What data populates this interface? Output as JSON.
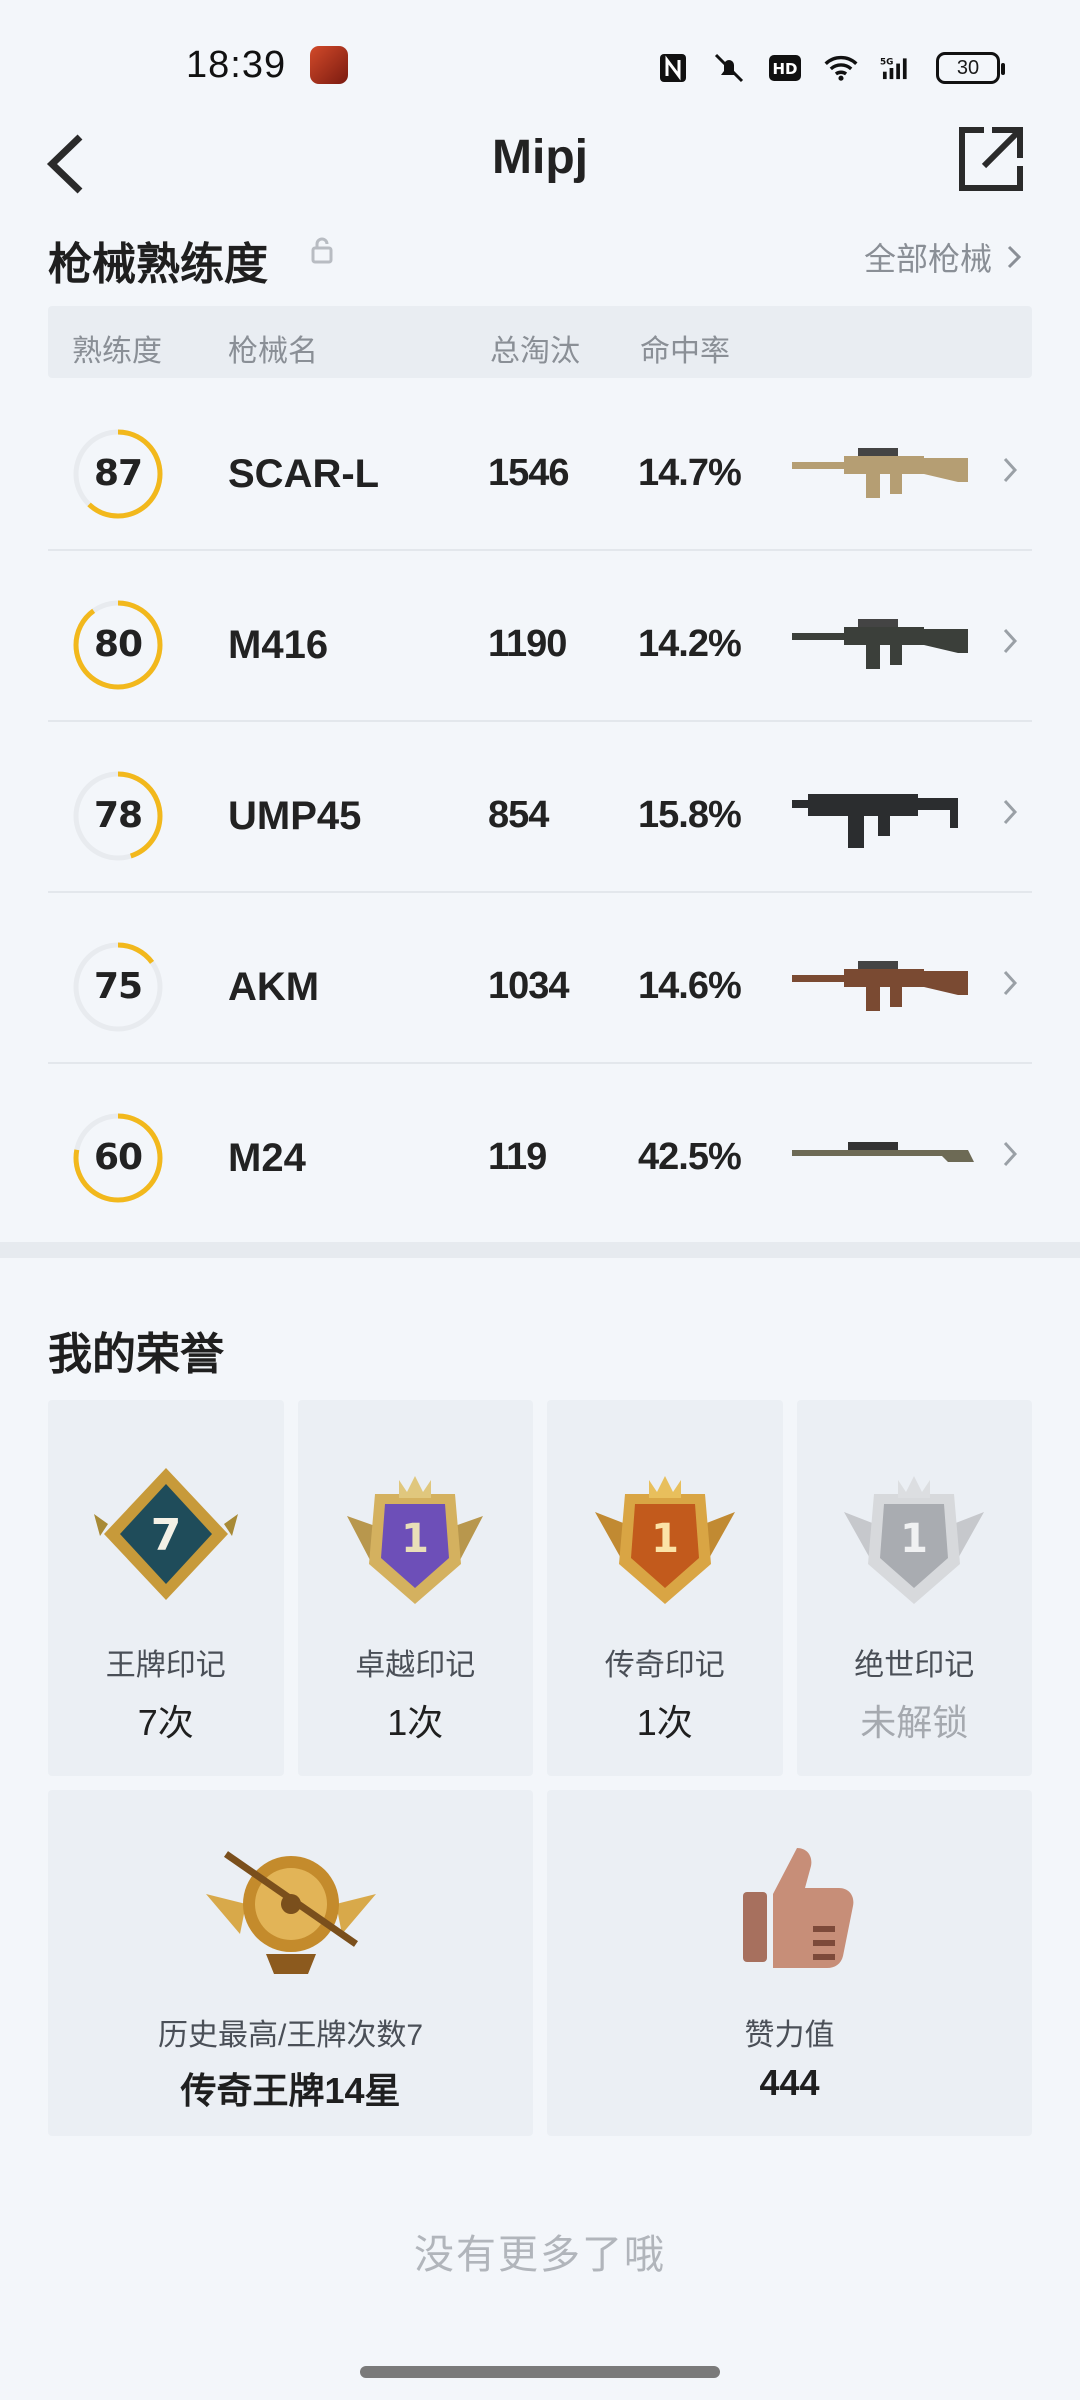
{
  "status_bar": {
    "time": "18:39",
    "battery": "30"
  },
  "header": {
    "title": "Mipj"
  },
  "weapons": {
    "section_title": "枪械熟练度",
    "all_link": "全部枪械",
    "columns": [
      "熟练度",
      "枪械名",
      "总淘汰",
      "命中率"
    ],
    "rows": [
      {
        "mastery": "87",
        "mastery_pct": 0.62,
        "name": "SCAR-L",
        "kills": "1546",
        "accuracy": "14.7%",
        "gun_color": "#b59e73"
      },
      {
        "mastery": "80",
        "mastery_pct": 0.9,
        "name": "M416",
        "kills": "1190",
        "accuracy": "14.2%",
        "gun_color": "#3b3f3a"
      },
      {
        "mastery": "78",
        "mastery_pct": 0.45,
        "name": "UMP45",
        "kills": "854",
        "accuracy": "15.8%",
        "gun_color": "#2b2d2f"
      },
      {
        "mastery": "75",
        "mastery_pct": 0.15,
        "name": "AKM",
        "kills": "1034",
        "accuracy": "14.6%",
        "gun_color": "#7a4a32"
      },
      {
        "mastery": "60",
        "mastery_pct": 0.78,
        "name": "M24",
        "kills": "119",
        "accuracy": "42.5%",
        "gun_color": "#6d6a55"
      }
    ]
  },
  "honors": {
    "title": "我的荣誉",
    "cards": [
      {
        "label": "王牌印记",
        "value": "7次",
        "badge_num": "7",
        "icon": "ace-badge-icon"
      },
      {
        "label": "卓越印记",
        "value": "1次",
        "badge_num": "1",
        "icon": "excellence-badge-icon"
      },
      {
        "label": "传奇印记",
        "value": "1次",
        "badge_num": "1",
        "icon": "legend-badge-icon"
      },
      {
        "label": "绝世印记",
        "value": "未解锁",
        "badge_num": "1",
        "icon": "peerless-badge-icon"
      }
    ],
    "highest": {
      "label": "历史最高/王牌次数7",
      "value": "传奇王牌14星"
    },
    "likes": {
      "label": "赞力值",
      "value": "444"
    }
  },
  "footer": {
    "no_more": "没有更多了哦"
  },
  "colors": {
    "accent": "#f2b81c",
    "ring_track": "#e8ebef"
  }
}
